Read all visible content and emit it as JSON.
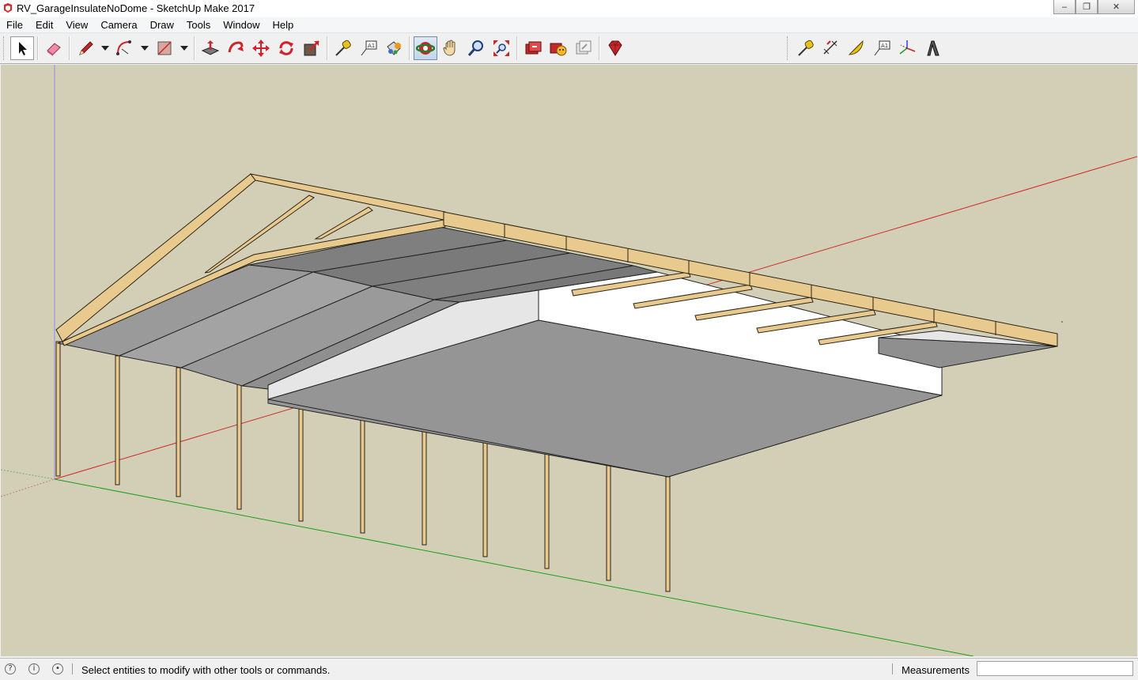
{
  "window": {
    "title": "RV_GarageInsulateNoDome - SketchUp Make 2017",
    "minimize": "–",
    "maximize": "❐",
    "close": "✕"
  },
  "menu": [
    "File",
    "Edit",
    "View",
    "Camera",
    "Draw",
    "Tools",
    "Window",
    "Help"
  ],
  "toolbar": {
    "left_tools": [
      "select",
      "eraser",
      "pencil",
      "pencil-dropdown",
      "arc",
      "arc-dropdown",
      "rectangle",
      "rectangle-dropdown",
      "push-pull",
      "follow-me",
      "move",
      "rotate",
      "scale",
      "tape-measure",
      "text",
      "paint-bucket",
      "orbit",
      "pan",
      "zoom",
      "zoom-extents",
      "3d-warehouse",
      "extension-warehouse",
      "layout",
      "extensions"
    ],
    "right_tools": [
      "tape-measure",
      "dimensions",
      "protractor",
      "text",
      "axes",
      "3d-text"
    ],
    "selected_tool": "orbit"
  },
  "status": {
    "message": "Select entities to modify with other tools or commands.",
    "measurements_label": "Measurements",
    "measurements_value": ""
  },
  "colors": {
    "sky": "#d3cfb7",
    "wood": "#e8c98e",
    "wood_edge": "#2a2214",
    "roof_panel_light": "#9a9a9a",
    "roof_panel_dark": "#7d7d7d",
    "insulation": "#ffffff",
    "axis_red": "#d61f1f",
    "axis_green": "#1a9e1a",
    "axis_blue": "#3b3bd6"
  }
}
